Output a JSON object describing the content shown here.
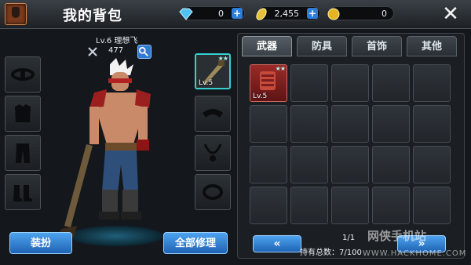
{
  "header": {
    "title": "我的背包",
    "diamond": "0",
    "gold_leaf": "2,455",
    "coin": "0",
    "close_icon": "close-icon"
  },
  "character": {
    "level_name": "Lv.6 理想飞",
    "power": "477"
  },
  "equipped_weapon": {
    "level": "Lv.5",
    "stars": "★★"
  },
  "buttons": {
    "dress_up": "装扮",
    "repair_all": "全部修理"
  },
  "tabs": [
    "武器",
    "防具",
    "首饰",
    "其他"
  ],
  "inventory": {
    "items": [
      {
        "level": "Lv.5",
        "stars": "★★"
      }
    ],
    "page": "1/1",
    "holding": "持有总数：7/100"
  },
  "watermark": {
    "brand": "网侠手机站",
    "url": "WWW.HACKHOME.COM"
  },
  "colors": {
    "accent_blue": "#2b7fd8",
    "tab_active": "#555d64",
    "item_red": "#9b2a28",
    "weapon_frame": "#37d0d0"
  }
}
